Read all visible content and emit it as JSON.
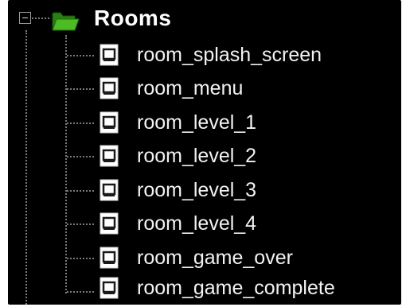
{
  "tree": {
    "root": {
      "label": "Rooms",
      "expanded": true,
      "icon": "folder-open-icon",
      "icon_color": "#3fa81c"
    },
    "items": [
      {
        "label": "room_splash_screen",
        "icon": "room-icon"
      },
      {
        "label": "room_menu",
        "icon": "room-icon"
      },
      {
        "label": "room_level_1",
        "icon": "room-icon"
      },
      {
        "label": "room_level_2",
        "icon": "room-icon"
      },
      {
        "label": "room_level_3",
        "icon": "room-icon"
      },
      {
        "label": "room_level_4",
        "icon": "room-icon"
      },
      {
        "label": "room_game_over",
        "icon": "room-icon"
      },
      {
        "label": "room_game_complete",
        "icon": "room-icon"
      }
    ],
    "colors": {
      "background": "#000000",
      "text": "#f2f2f2",
      "connector": "#7a7a7a"
    }
  }
}
